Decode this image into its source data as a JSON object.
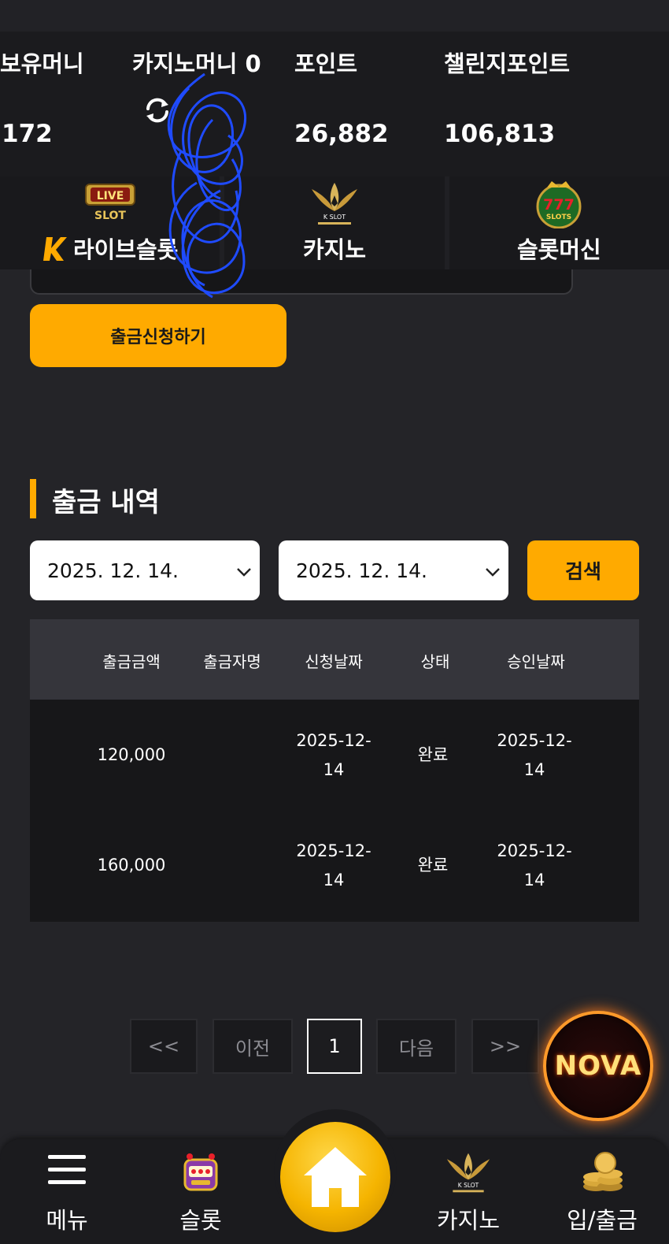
{
  "balance": {
    "holding_money_label": "보유머니",
    "holding_money_value": "172",
    "casino_money_label": "카지노머니 0",
    "points_label": "포인트",
    "points_value": "26,882",
    "challenge_points_label": "챌린지포인트",
    "challenge_points_value": "106,813",
    "refresh_icon": "refresh-icon"
  },
  "game_tabs": [
    {
      "label": "라이브슬롯",
      "icon": "live-slot-logo"
    },
    {
      "label": "카지노",
      "icon": "k-slot-lotus-logo"
    },
    {
      "label": "슬롯머신",
      "icon": "777-slots-logo"
    }
  ],
  "withdraw": {
    "submit_label": "출금신청하기"
  },
  "history": {
    "title": "출금 내역",
    "start_date": "2025. 12. 14.",
    "end_date": "2025. 12. 14.",
    "search_label": "검색",
    "columns": [
      "출금금액",
      "출금자명",
      "신청날짜",
      "상태",
      "승인날짜"
    ],
    "rows": [
      {
        "amount": "120,000",
        "name": "",
        "request_date": "2025-12-\n14",
        "status": "완료",
        "approve_date": "2025-12-\n14"
      },
      {
        "amount": "160,000",
        "name": "",
        "request_date": "2025-12-\n14",
        "status": "완료",
        "approve_date": "2025-12-\n14"
      }
    ]
  },
  "pagination": {
    "first": "<<",
    "prev": "이전",
    "current": "1",
    "next": "다음",
    "last": ">>"
  },
  "floating_logo": "NOVA",
  "bottom_nav": {
    "menu": "메뉴",
    "slot": "슬롯",
    "home_icon": "home-icon",
    "casino": "카지노",
    "deposit_withdraw": "입/출금"
  },
  "colors": {
    "accent": "#ffaa00",
    "background": "#242428",
    "scribble": "#1f4bff"
  }
}
